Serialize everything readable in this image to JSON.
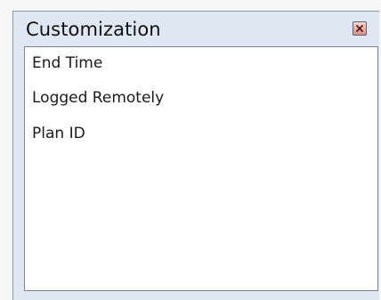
{
  "window": {
    "title": "Customization",
    "close_icon": "close-icon"
  },
  "list": {
    "items": [
      {
        "label": "End Time"
      },
      {
        "label": "Logged Remotely"
      },
      {
        "label": "Plan ID"
      }
    ]
  },
  "colors": {
    "panel_bg": "#dfe7f2",
    "list_bg": "#ffffff",
    "close_button": "#d98f87"
  }
}
